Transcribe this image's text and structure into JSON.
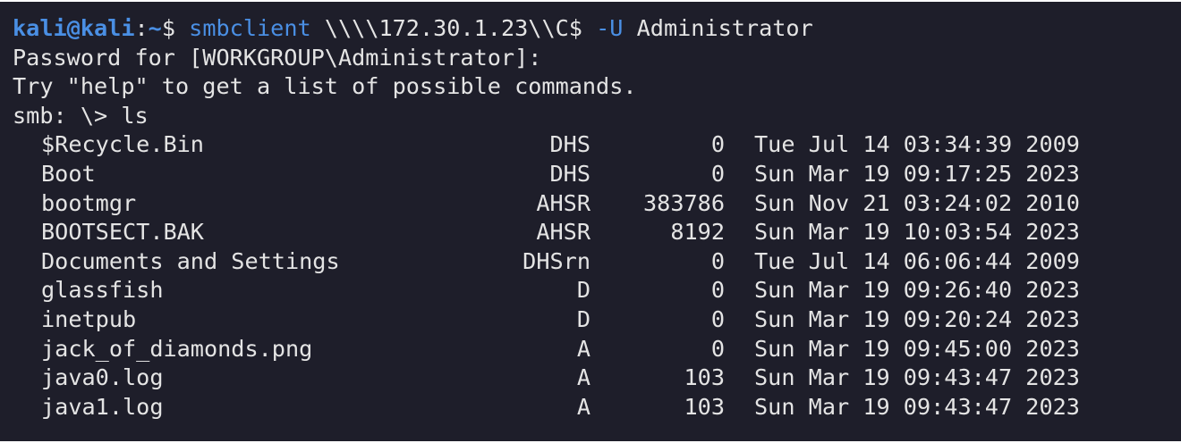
{
  "prompt": {
    "user_host": "kali@kali",
    "separator": ":",
    "path": "~",
    "symbol": "$ ",
    "command": "smbclient",
    "args": " \\\\\\\\172.30.1.23\\\\C$ ",
    "flag": "-U",
    "flag_value": " Administrator"
  },
  "output": {
    "password_line": "Password for [WORKGROUP\\Administrator]:",
    "help_line": "Try \"help\" to get a list of possible commands.",
    "smb_prompt": "smb: \\> ls"
  },
  "listing": [
    {
      "name": "$Recycle.Bin",
      "attr": "DHS",
      "size": "0",
      "date": "Tue Jul 14 03:34:39 2009"
    },
    {
      "name": "Boot",
      "attr": "DHS",
      "size": "0",
      "date": "Sun Mar 19 09:17:25 2023"
    },
    {
      "name": "bootmgr",
      "attr": "AHSR",
      "size": "383786",
      "date": "Sun Nov 21 03:24:02 2010"
    },
    {
      "name": "BOOTSECT.BAK",
      "attr": "AHSR",
      "size": "8192",
      "date": "Sun Mar 19 10:03:54 2023"
    },
    {
      "name": "Documents and Settings",
      "attr": "DHSrn",
      "size": "0",
      "date": "Tue Jul 14 06:06:44 2009"
    },
    {
      "name": "glassfish",
      "attr": "D",
      "size": "0",
      "date": "Sun Mar 19 09:26:40 2023"
    },
    {
      "name": "inetpub",
      "attr": "D",
      "size": "0",
      "date": "Sun Mar 19 09:20:24 2023"
    },
    {
      "name": "jack_of_diamonds.png",
      "attr": "A",
      "size": "0",
      "date": "Sun Mar 19 09:45:00 2023"
    },
    {
      "name": "java0.log",
      "attr": "A",
      "size": "103",
      "date": "Sun Mar 19 09:43:47 2023"
    },
    {
      "name": "java1.log",
      "attr": "A",
      "size": "103",
      "date": "Sun Mar 19 09:43:47 2023"
    }
  ],
  "colors": {
    "background": "#1e1e2a",
    "text": "#e4e4e4",
    "accent": "#4a8fe4"
  }
}
